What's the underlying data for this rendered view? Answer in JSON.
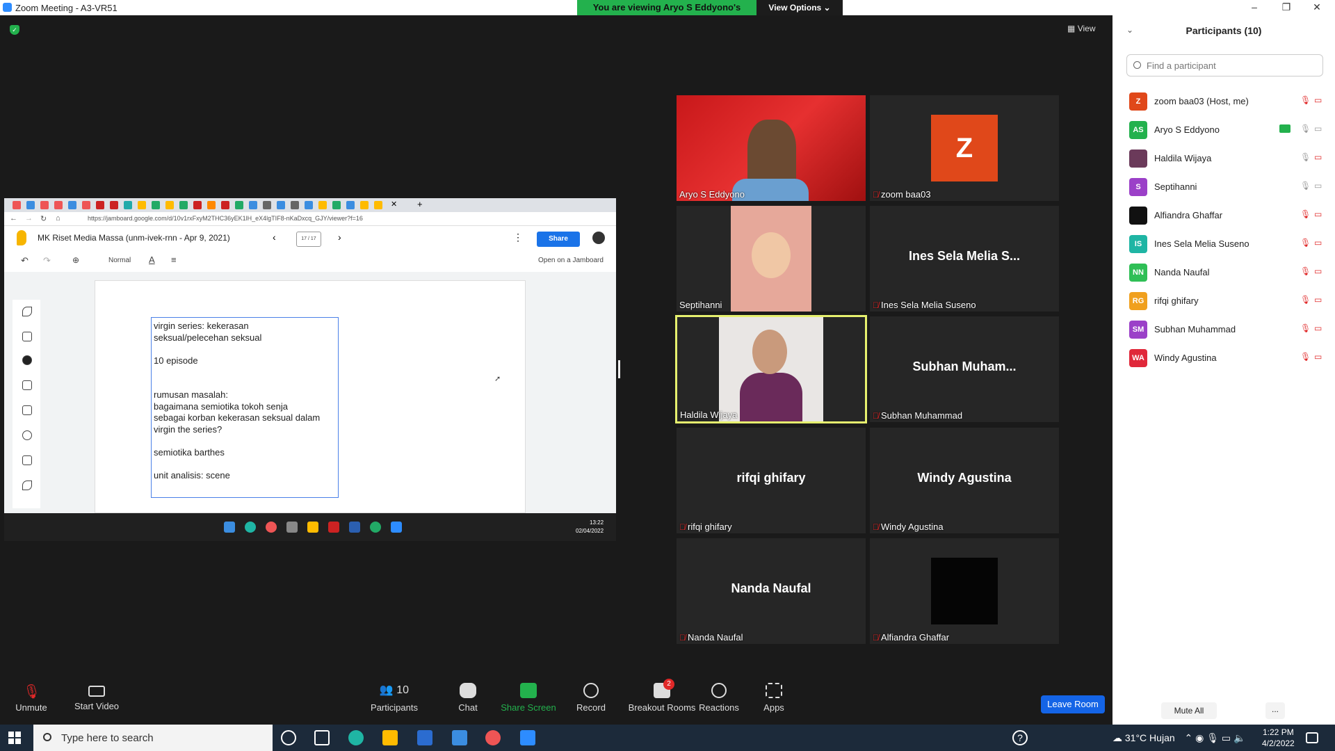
{
  "window": {
    "title": "Zoom Meeting - A3-VR51",
    "banner": "You are viewing Aryo S Eddyono's screen",
    "view_options": "View Options"
  },
  "view_toggle": "View",
  "shared_screen": {
    "url": "https://jamboard.google.com/d/10v1rxFxyM2THC36yEK1lH_eX4lgTIF8-nKaDxcq_GJY/viewer?f=16",
    "jam_title": "MK Riset Media Massa (unm-ivek-rnn - Apr 9, 2021)",
    "frame_counter": "17 / 17",
    "share_label": "Share",
    "zoom_level": "Normal",
    "open_jamboard": "Open on a Jamboard",
    "note_text": "virgin series: kekerasan\nseksual/pelecehan seksual\n\n10 episode\n\n\nrumusan masalah:\nbagaimana semiotika tokoh senja\nsebagai korban kekerasan seksual dalam\nvirgin the series?\n\nsemiotika barthes\n\nunit analisis: scene",
    "inner_clock_time": "13:22",
    "inner_clock_date": "02/04/2022"
  },
  "tiles": [
    {
      "name": "Aryo S Eddyono",
      "big": "",
      "muted": false
    },
    {
      "name": "zoom baa03",
      "big": "Z",
      "muted": true
    },
    {
      "name": "Septihanni",
      "big": "",
      "muted": false
    },
    {
      "name": "Ines Sela Melia Suseno",
      "big": "Ines Sela Melia S...",
      "muted": true
    },
    {
      "name": "Haldila Wijaya",
      "big": "",
      "muted": false
    },
    {
      "name": "Subhan Muhammad",
      "big": "Subhan Muham...",
      "muted": true
    },
    {
      "name": "rifqi ghifary",
      "big": "rifqi ghifary",
      "muted": true
    },
    {
      "name": "Windy Agustina",
      "big": "Windy Agustina",
      "muted": true
    },
    {
      "name": "Nanda Naufal",
      "big": "Nanda Naufal",
      "muted": true
    },
    {
      "name": "Alfiandra Ghaffar",
      "big": "",
      "muted": true
    }
  ],
  "controls": {
    "unmute": "Unmute",
    "start_video": "Start Video",
    "participants": "Participants",
    "participants_count": "10",
    "chat": "Chat",
    "share_screen": "Share Screen",
    "record": "Record",
    "breakout_rooms": "Breakout Rooms",
    "breakout_badge": "2",
    "reactions": "Reactions",
    "apps": "Apps",
    "leave_room": "Leave Room"
  },
  "participants_panel": {
    "title": "Participants (10)",
    "search_placeholder": "Find a participant",
    "mute_all": "Mute All",
    "more": "...",
    "list": [
      {
        "initials": "Z",
        "name": "zoom baa03 (Host, me)",
        "color": "#e0481a"
      },
      {
        "initials": "AS",
        "name": "Aryo S Eddyono",
        "color": "#23b14d"
      },
      {
        "initials": "",
        "name": "Haldila Wijaya",
        "color": "#6b3a5a"
      },
      {
        "initials": "S",
        "name": "Septihanni",
        "color": "#9b40c8"
      },
      {
        "initials": "",
        "name": "Alfiandra Ghaffar",
        "color": "#111111"
      },
      {
        "initials": "IS",
        "name": "Ines Sela Melia Suseno",
        "color": "#1fb5a4"
      },
      {
        "initials": "NN",
        "name": "Nanda Naufal",
        "color": "#2fbf56"
      },
      {
        "initials": "RG",
        "name": "rifqi ghifary",
        "color": "#f0a01e"
      },
      {
        "initials": "SM",
        "name": "Subhan Muhammad",
        "color": "#9b40c8"
      },
      {
        "initials": "WA",
        "name": "Windy Agustina",
        "color": "#e0283a"
      }
    ]
  },
  "taskbar": {
    "search_placeholder": "Type here to search",
    "weather": "31°C  Hujan",
    "time": "1:22 PM",
    "date": "4/2/2022"
  }
}
